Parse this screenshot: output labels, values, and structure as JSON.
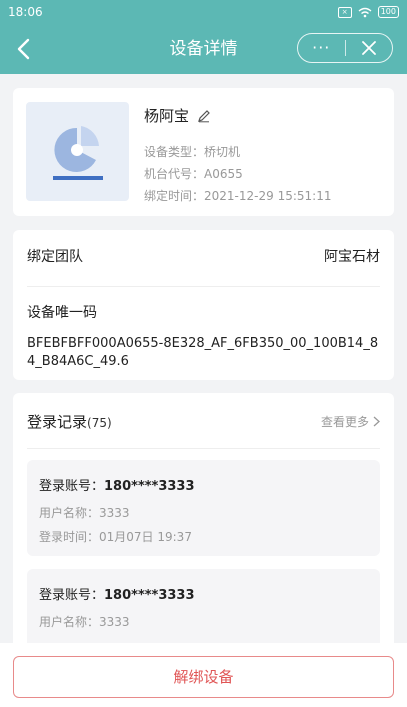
{
  "status_bar": {
    "time": "18:06",
    "battery": "100"
  },
  "nav": {
    "title": "设备详情",
    "more_label": "···"
  },
  "device": {
    "name": "杨阿宝",
    "type_label": "设备类型：",
    "type_value": "桥切机",
    "code_label": "机台代号：",
    "code_value": "A0655",
    "bind_time_label": "绑定时间：",
    "bind_time_value": "2021-12-29 15:51:11"
  },
  "team": {
    "label": "绑定团队",
    "value": "阿宝石材",
    "uid_label": "设备唯一码",
    "uid_value": "BFEBFBFF000A0655-8E328_AF_6FB350_00_100B14_84_B84A6C_49.6"
  },
  "login": {
    "title": "登录记录",
    "count": "(75)",
    "view_more": "查看更多",
    "records": [
      {
        "account_label": "登录账号：",
        "account": "180****3333",
        "user_label": "用户名称：",
        "user": "3333",
        "time_label": "登录时间：",
        "time": "01月07日 19:37"
      },
      {
        "account_label": "登录账号：",
        "account": "180****3333",
        "user_label": "用户名称：",
        "user": "3333"
      }
    ]
  },
  "actions": {
    "unbind_label": "解绑设备"
  },
  "colors": {
    "primary": "#5cb8b4",
    "danger": "#e05656"
  }
}
